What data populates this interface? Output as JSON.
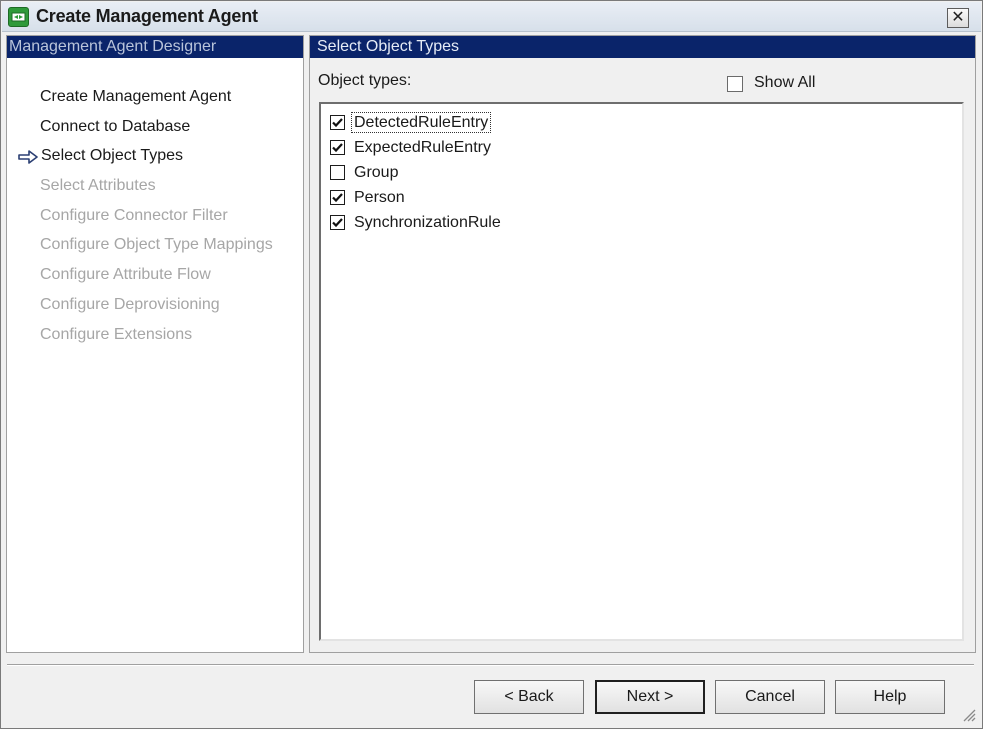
{
  "window": {
    "title": "Create Management Agent",
    "close_glyph": "✕"
  },
  "left_pane": {
    "header": "Management Agent Designer",
    "steps": [
      {
        "label": "Create Management Agent",
        "state": "enabled"
      },
      {
        "label": "Connect to Database",
        "state": "enabled"
      },
      {
        "label": "Select Object Types",
        "state": "current"
      },
      {
        "label": "Select Attributes",
        "state": "disabled"
      },
      {
        "label": "Configure Connector Filter",
        "state": "disabled"
      },
      {
        "label": "Configure Object Type Mappings",
        "state": "disabled"
      },
      {
        "label": "Configure Attribute Flow",
        "state": "disabled"
      },
      {
        "label": "Configure Deprovisioning",
        "state": "disabled"
      },
      {
        "label": "Configure Extensions",
        "state": "disabled"
      }
    ]
  },
  "right_pane": {
    "header": "Select Object Types",
    "object_types_label": "Object types:",
    "show_all": {
      "label": "Show All",
      "checked": false
    },
    "object_types": [
      {
        "label": "DetectedRuleEntry",
        "checked": true,
        "focused": true
      },
      {
        "label": "ExpectedRuleEntry",
        "checked": true,
        "focused": false
      },
      {
        "label": "Group",
        "checked": false,
        "focused": false
      },
      {
        "label": "Person",
        "checked": true,
        "focused": false
      },
      {
        "label": "SynchronizationRule",
        "checked": true,
        "focused": false
      }
    ]
  },
  "buttons": {
    "back": "< Back",
    "next": "Next >",
    "cancel": "Cancel",
    "help": "Help"
  },
  "colors": {
    "header_bg": "#0a246a",
    "disabled_text": "#a6a6a6",
    "window_bg": "#f0f0f0"
  },
  "icons": {
    "app": "management-agent-icon",
    "current_step": "right-arrow-icon",
    "check": "checkmark-icon",
    "resize": "resize-grip-icon"
  }
}
